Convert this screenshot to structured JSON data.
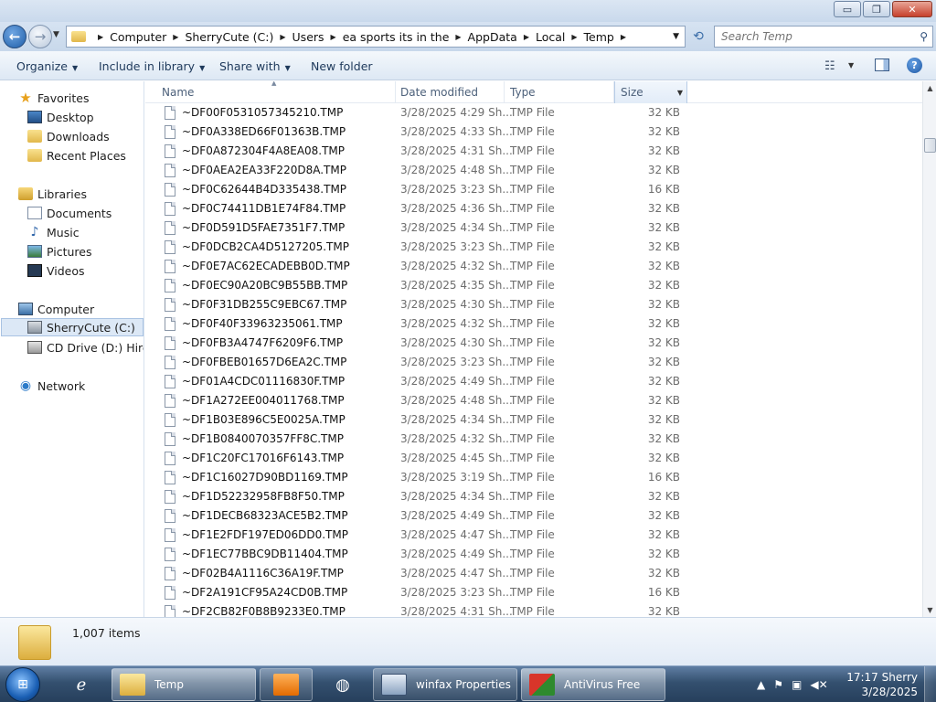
{
  "window": {
    "minimize": "▭",
    "maximize": "❐",
    "close": "✕"
  },
  "address": {
    "crumbs": [
      "Computer",
      "SherryCute (C:)",
      "Users",
      "ea sports its in the",
      "AppData",
      "Local",
      "Temp"
    ],
    "search_placeholder": "Search Temp"
  },
  "toolbar": {
    "organize": "Organize",
    "include_in_library": "Include in library",
    "share_with": "Share with",
    "new_folder": "New folder"
  },
  "nav": {
    "favorites": "Favorites",
    "desktop": "Desktop",
    "downloads": "Downloads",
    "recent_places": "Recent Places",
    "libraries": "Libraries",
    "documents": "Documents",
    "music": "Music",
    "pictures": "Pictures",
    "videos": "Videos",
    "computer": "Computer",
    "c_drive": "SherryCute (C:)",
    "d_drive": "CD Drive (D:) Hiren's",
    "network": "Network"
  },
  "columns": {
    "name": "Name",
    "date_modified": "Date modified",
    "type": "Type",
    "size": "Size"
  },
  "files": [
    {
      "name": "~DF00F0531057345210.TMP",
      "date": "3/28/2025 4:29 Sh...",
      "type": "TMP File",
      "size": "32 KB"
    },
    {
      "name": "~DF0A338ED66F01363B.TMP",
      "date": "3/28/2025 4:33 Sh...",
      "type": "TMP File",
      "size": "32 KB"
    },
    {
      "name": "~DF0A872304F4A8EA08.TMP",
      "date": "3/28/2025 4:31 Sh...",
      "type": "TMP File",
      "size": "32 KB"
    },
    {
      "name": "~DF0AEA2EA33F220D8A.TMP",
      "date": "3/28/2025 4:48 Sh...",
      "type": "TMP File",
      "size": "32 KB"
    },
    {
      "name": "~DF0C62644B4D335438.TMP",
      "date": "3/28/2025 3:23 Sh...",
      "type": "TMP File",
      "size": "16 KB"
    },
    {
      "name": "~DF0C74411DB1E74F84.TMP",
      "date": "3/28/2025 4:36 Sh...",
      "type": "TMP File",
      "size": "32 KB"
    },
    {
      "name": "~DF0D591D5FAE7351F7.TMP",
      "date": "3/28/2025 4:34 Sh...",
      "type": "TMP File",
      "size": "32 KB"
    },
    {
      "name": "~DF0DCB2CA4D5127205.TMP",
      "date": "3/28/2025 3:23 Sh...",
      "type": "TMP File",
      "size": "32 KB"
    },
    {
      "name": "~DF0E7AC62ECADEBB0D.TMP",
      "date": "3/28/2025 4:32 Sh...",
      "type": "TMP File",
      "size": "32 KB"
    },
    {
      "name": "~DF0EC90A20BC9B55BB.TMP",
      "date": "3/28/2025 4:35 Sh...",
      "type": "TMP File",
      "size": "32 KB"
    },
    {
      "name": "~DF0F31DB255C9EBC67.TMP",
      "date": "3/28/2025 4:30 Sh...",
      "type": "TMP File",
      "size": "32 KB"
    },
    {
      "name": "~DF0F40F33963235061.TMP",
      "date": "3/28/2025 4:32 Sh...",
      "type": "TMP File",
      "size": "32 KB"
    },
    {
      "name": "~DF0FB3A4747F6209F6.TMP",
      "date": "3/28/2025 4:30 Sh...",
      "type": "TMP File",
      "size": "32 KB"
    },
    {
      "name": "~DF0FBEB01657D6EA2C.TMP",
      "date": "3/28/2025 3:23 Sh...",
      "type": "TMP File",
      "size": "32 KB"
    },
    {
      "name": "~DF01A4CDC01116830F.TMP",
      "date": "3/28/2025 4:49 Sh...",
      "type": "TMP File",
      "size": "32 KB"
    },
    {
      "name": "~DF1A272EE004011768.TMP",
      "date": "3/28/2025 4:48 Sh...",
      "type": "TMP File",
      "size": "32 KB"
    },
    {
      "name": "~DF1B03E896C5E0025A.TMP",
      "date": "3/28/2025 4:34 Sh...",
      "type": "TMP File",
      "size": "32 KB"
    },
    {
      "name": "~DF1B0840070357FF8C.TMP",
      "date": "3/28/2025 4:32 Sh...",
      "type": "TMP File",
      "size": "32 KB"
    },
    {
      "name": "~DF1C20FC17016F6143.TMP",
      "date": "3/28/2025 4:45 Sh...",
      "type": "TMP File",
      "size": "32 KB"
    },
    {
      "name": "~DF1C16027D90BD1169.TMP",
      "date": "3/28/2025 3:19 Sh...",
      "type": "TMP File",
      "size": "16 KB"
    },
    {
      "name": "~DF1D52232958FB8F50.TMP",
      "date": "3/28/2025 4:34 Sh...",
      "type": "TMP File",
      "size": "32 KB"
    },
    {
      "name": "~DF1DECB68323ACE5B2.TMP",
      "date": "3/28/2025 4:49 Sh...",
      "type": "TMP File",
      "size": "32 KB"
    },
    {
      "name": "~DF1E2FDF197ED06DD0.TMP",
      "date": "3/28/2025 4:47 Sh...",
      "type": "TMP File",
      "size": "32 KB"
    },
    {
      "name": "~DF1EC77BBC9DB11404.TMP",
      "date": "3/28/2025 4:49 Sh...",
      "type": "TMP File",
      "size": "32 KB"
    },
    {
      "name": "~DF02B4A1116C36A19F.TMP",
      "date": "3/28/2025 4:47 Sh...",
      "type": "TMP File",
      "size": "32 KB"
    },
    {
      "name": "~DF2A191CF95A24CD0B.TMP",
      "date": "3/28/2025 3:23 Sh...",
      "type": "TMP File",
      "size": "16 KB"
    },
    {
      "name": "~DF2CB82F0B8B9233E0.TMP",
      "date": "3/28/2025 4:31 Sh...",
      "type": "TMP File",
      "size": "32 KB"
    }
  ],
  "details": {
    "item_count": "1,007 items"
  },
  "taskbar": {
    "temp": "Temp",
    "winfax": "winfax Properties",
    "antivirus": "AntiVirus Free",
    "time": "17:17 Sherry",
    "date": "3/28/2025"
  },
  "colors": {
    "accent": "#1f5ea8",
    "taskbar": "#34506f",
    "selection": "#dce8f6"
  }
}
